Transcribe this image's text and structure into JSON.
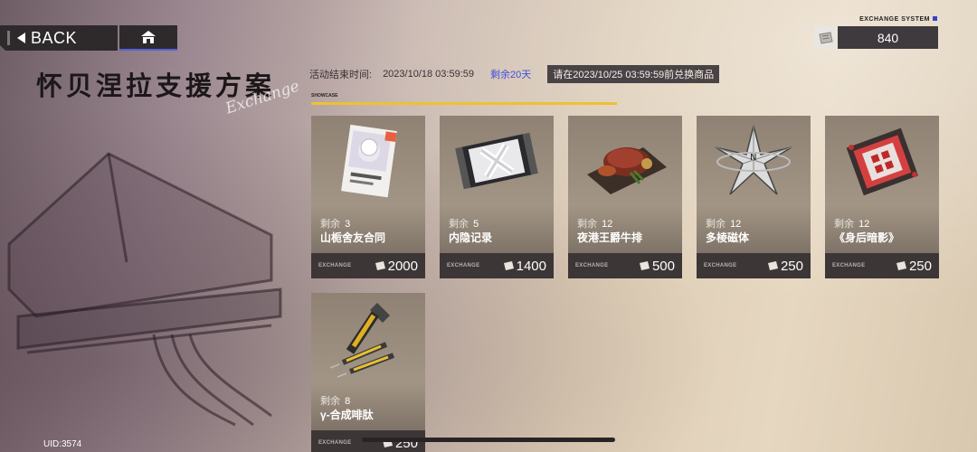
{
  "nav": {
    "back_label": "BACK",
    "home_icon": "home-icon"
  },
  "title": {
    "main": "怀贝涅拉支援方案",
    "decor": "Exchange"
  },
  "currency": {
    "system_label": "EXCHANGE SYSTEM",
    "amount": "840",
    "icon": "ticket-icon"
  },
  "event": {
    "end_label": "活动结束时间:",
    "end_date": "2023/10/18 03:59:59",
    "remaining": "剩余20天",
    "redeem_note": "请在2023/10/25 03:59:59前兑换商品"
  },
  "showcase_label": "SHOWCASE",
  "stock_label": "剩余",
  "exchange_label": "EXCHANGE",
  "items": [
    {
      "stock": "3",
      "name": "山栀舍友合同",
      "price": "2000",
      "icon": "contract-card-icon"
    },
    {
      "stock": "5",
      "name": "内隐记录",
      "price": "1400",
      "icon": "sealed-record-icon"
    },
    {
      "stock": "12",
      "name": "夜港王爵牛排",
      "price": "500",
      "icon": "steak-icon"
    },
    {
      "stock": "12",
      "name": "多棱磁体",
      "price": "250",
      "icon": "magnet-crystal-icon"
    },
    {
      "stock": "12",
      "name": "《身后暗影》",
      "price": "250",
      "icon": "board-game-icon"
    },
    {
      "stock": "8",
      "name": "γ-合成啡肽",
      "price": "250",
      "icon": "syringe-icon"
    }
  ],
  "uid": "UID:3574",
  "colors": {
    "accent": "#5661d6",
    "progress": "#f0c030",
    "remaining": "#4050d8"
  }
}
